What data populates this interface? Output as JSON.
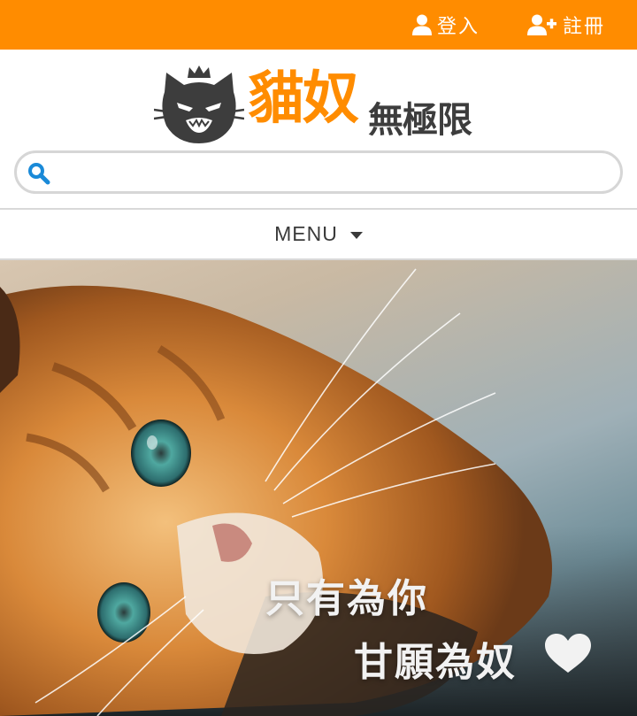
{
  "colors": {
    "accent": "#ff8c00",
    "dark": "#3d3d3d",
    "search_icon": "#1a8ad8",
    "border": "#d6d6d6"
  },
  "topbar": {
    "login": {
      "icon": "user-icon",
      "label": "登入"
    },
    "register": {
      "icon": "user-plus-icon",
      "label": "註冊"
    }
  },
  "logo": {
    "icon": "cat-crown-icon",
    "main": "貓奴",
    "sub": "無極限"
  },
  "search": {
    "icon": "search-icon",
    "value": "",
    "placeholder": ""
  },
  "menu": {
    "label": "MENU",
    "icon": "caret-down-icon"
  },
  "hero": {
    "image": "orange-cat-photo",
    "line1": "只有為你",
    "line2": "甘願為奴",
    "icon": "heart-icon"
  }
}
